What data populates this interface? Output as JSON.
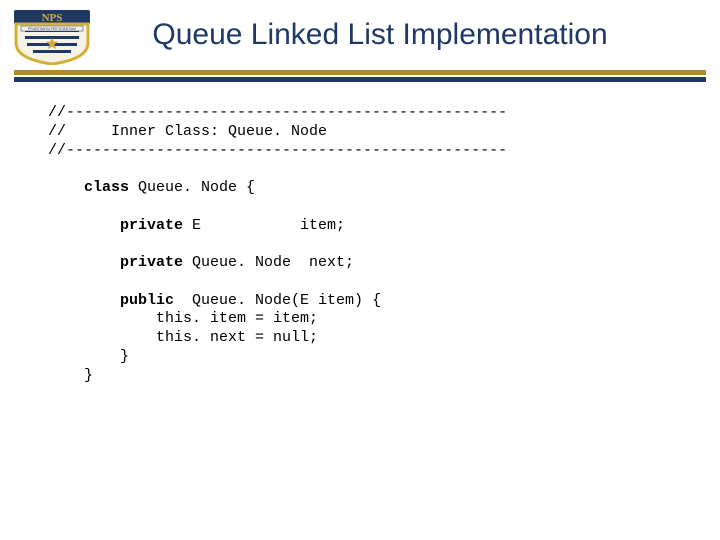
{
  "header": {
    "title": "Queue Linked List Implementation",
    "logo_top_text": "NPS",
    "logo_motto": "PRAESTANTIA PER SCIENTIAM"
  },
  "code": {
    "comment_sep_top": "//-------------------------------------------------",
    "comment_label": "//     Inner Class: Queue. Node",
    "comment_sep_bot": "//-------------------------------------------------",
    "class_kw": "class",
    "class_decl_rest": " Queue. Node {",
    "field1_kw": "private",
    "field1_rest": " E           item;",
    "field2_kw": "private",
    "field2_rest": " Queue. Node  next;",
    "ctor_kw": "public",
    "ctor_rest": "  Queue. Node(E item) {",
    "ctor_body1": "this. item = item;",
    "ctor_body2": "this. next = null;",
    "close_inner": "}",
    "close_outer": "}"
  }
}
